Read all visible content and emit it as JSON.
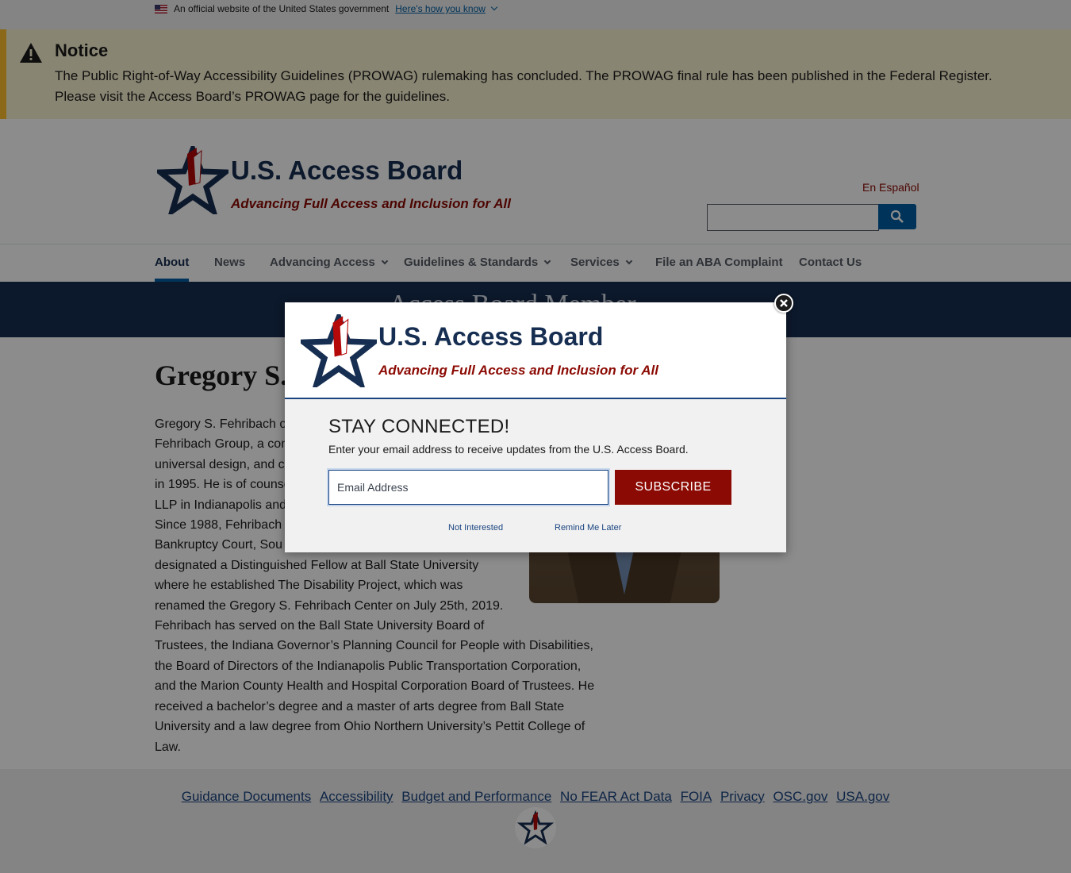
{
  "gov_banner": {
    "text": "An official website of the United States government",
    "link": "Here's how you know"
  },
  "notice": {
    "title": "Notice",
    "body": "The Public Right-of-Way Accessibility Guidelines (PROWAG) rulemaking has concluded. The PROWAG final rule has been published in the Federal Register. Please visit the Access Board’s PROWAG page for the guidelines."
  },
  "header": {
    "title": "U.S. Access Board",
    "tagline": "Advancing Full Access and Inclusion for All",
    "language_link": "En Español",
    "search_placeholder": ""
  },
  "nav": {
    "items": [
      {
        "label": "About"
      },
      {
        "label": "News"
      },
      {
        "label": "Advancing Access"
      },
      {
        "label": "Guidelines & Standards"
      },
      {
        "label": "Services"
      },
      {
        "label": "File an ABA Complaint"
      },
      {
        "label": "Contact Us"
      }
    ]
  },
  "hero": {
    "title": "Access Board Member"
  },
  "member": {
    "name": "Gregory S. Fehribach",
    "bio_lines": [
      "Gregory S. Fehribach of",
      "Fehribach Group, a con",
      "universal design, and c",
      "in 1995. He is of counse",
      "LLP in Indianapolis and",
      "Since 1988, Fehribach h",
      "Bankruptcy Court, Sou",
      "designated a Distinguished Fellow at Ball State University",
      "where he established The Disability Project, which was",
      "renamed the Gregory S. Fehribach Center on July 25th, 2019.",
      "Fehribach has served on the Ball State University Board of",
      "Trustees, the Indiana Governor’s Planning Council for People with Disabilities,",
      "the Board of Directors of the Indianapolis Public Transportation Corporation,",
      "and the Marion County Health and Hospital Corporation Board of Trustees. He",
      "received a bachelor’s degree and a master of arts degree from Ball State",
      "University and a law degree from Ohio Northern University’s Pettit College of",
      "Law."
    ]
  },
  "footer": {
    "links": [
      "Guidance Documents",
      "Accessibility",
      "Budget and Performance",
      "No FEAR Act Data",
      "FOIA",
      "Privacy",
      "OSC.gov",
      "USA.gov"
    ]
  },
  "modal": {
    "title": "U.S. Access Board",
    "tagline": "Advancing Full Access and Inclusion for All",
    "heading": "STAY CONNECTED!",
    "description": "Enter your email address to receive updates from the U.S. Access Board.",
    "email_placeholder": "Email Address",
    "subscribe_label": "SUBSCRIBE",
    "not_interested": "Not Interested",
    "remind_later": "Remind Me Later"
  },
  "colors": {
    "navy": "#162e51",
    "brand_red": "#8b0a03",
    "link_blue": "#005ea2",
    "notice_bg": "#faf3d1",
    "notice_accent": "#ffbe2e"
  },
  "icons": [
    "us-flag-icon",
    "warning-icon",
    "logo-star-icon",
    "search-icon",
    "chevron-down-icon",
    "close-icon"
  ]
}
